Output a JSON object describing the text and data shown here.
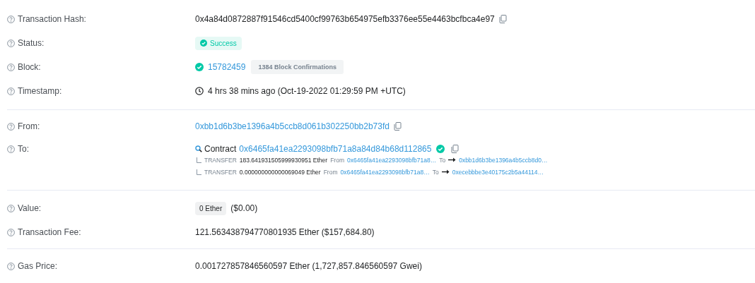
{
  "groups": [
    {
      "rows": [
        {
          "kind": "hash",
          "label": "Transaction Hash:",
          "text": "0x4a84d0872887f91546cd5400cf99763b654975efb3376ee55e4463bcfbca4e97"
        },
        {
          "kind": "status",
          "label": "Status:",
          "success": true,
          "text": "Success"
        },
        {
          "kind": "block",
          "label": "Block:",
          "text": "15782459",
          "badge": "1384 Block Confirmations"
        },
        {
          "kind": "timestamp",
          "label": "Timestamp:",
          "text": "4 hrs 38 mins ago (Oct-19-2022 01:29:59 PM +UTC)"
        }
      ]
    },
    {
      "rows": [
        {
          "kind": "address",
          "label": "From:",
          "text": "0xbb1d6b3be1396a4b5ccb8d061b302250bb2b73fd"
        },
        {
          "kind": "contract",
          "label": "To:",
          "prefix": "Contract",
          "text": "0x6465fa41ea2293098bfb71a8a84d84b68d112865",
          "transfers": [
            {
              "type": "TRANSFER",
              "amount": "183.641931505999930951 Ether",
              "from_label": "From",
              "from": "0x6465fa41ea2293098bfb71a8…",
              "to_label": "To",
              "to": "0xbb1d6b3be1396a4b5ccb8d0…"
            },
            {
              "type": "TRANSFER",
              "amount": "0.000000000000069049 Ether",
              "from_label": "From",
              "from": "0x6465fa41ea2293098bfb71a8…",
              "to_label": "To",
              "to": "0xecebbbe3e40175c2b5a44114…"
            }
          ]
        }
      ]
    },
    {
      "rows": [
        {
          "kind": "value",
          "label": "Value:",
          "badge": "0 Ether",
          "text": "($0.00)"
        },
        {
          "kind": "text",
          "label": "Transaction Fee:",
          "text": "121.563438794770801935 Ether ($157,684.80)"
        }
      ]
    },
    {
      "rows": [
        {
          "kind": "text",
          "label": "Gas Price:",
          "text": "0.001727857846560597 Ether (1,727,857.846560597 Gwei)"
        }
      ]
    }
  ]
}
